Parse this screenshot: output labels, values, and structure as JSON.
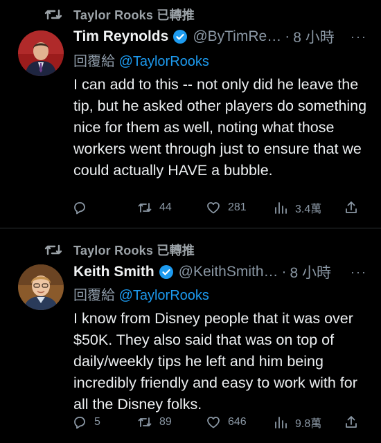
{
  "tweets": [
    {
      "retweet_label": "Taylor Rooks 已轉推",
      "author_name": "Tim Reynolds",
      "handle": "@ByTimRe…",
      "separator": "·",
      "time": "8 小時",
      "more": "···",
      "reply_prefix": "回覆給",
      "reply_to": "@TaylorRooks",
      "body": "I can add to this -- not only did he leave the tip, but he asked other players do something nice for them as well, noting what those workers went through just to ensure that we could actually HAVE a bubble.",
      "stats": {
        "replies": "",
        "retweets": "44",
        "likes": "281",
        "views": "3.4萬"
      }
    },
    {
      "retweet_label": "Taylor Rooks 已轉推",
      "author_name": "Keith Smith",
      "handle": "@KeithSmith…",
      "separator": "·",
      "time": "8 小時",
      "more": "···",
      "reply_prefix": "回覆給",
      "reply_to": "@TaylorRooks",
      "body": "I know from Disney people that it was over $50K. They also said that was on top of daily/weekly tips he left and him being incredibly friendly and easy to work with for all the Disney folks.",
      "stats": {
        "replies": "5",
        "retweets": "89",
        "likes": "646",
        "views": "9.8萬"
      }
    }
  ],
  "colors": {
    "background": "#000000",
    "accent": "#1d9bf0",
    "muted": "#8b98a5",
    "text": "#e7e9ea"
  }
}
